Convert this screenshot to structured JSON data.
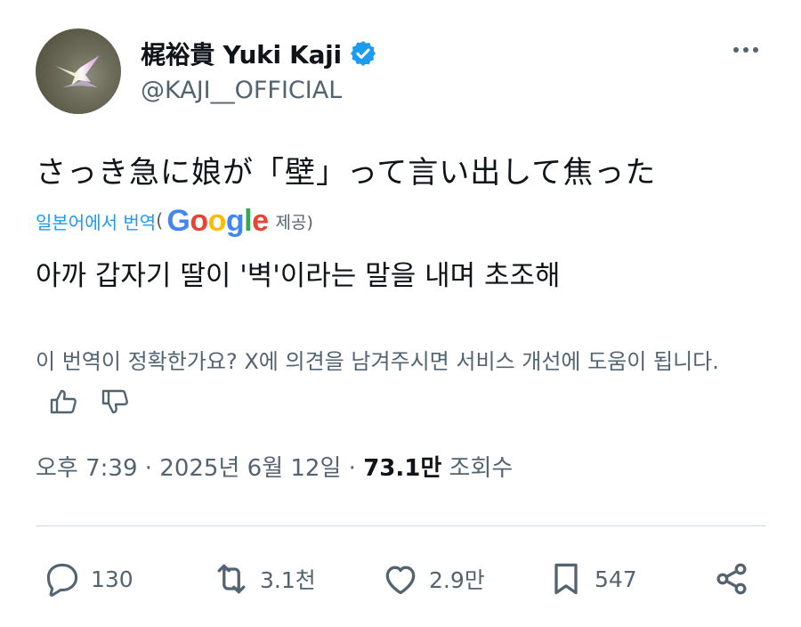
{
  "author": {
    "display_name": "梶裕貴 Yuki Kaji",
    "handle": "@KAJI__OFFICIAL",
    "verified_icon": "verified-badge-icon",
    "accent": "#1d9bf0"
  },
  "tweet": {
    "text": "さっき急に娘が「壁」って言い出して焦った"
  },
  "translation": {
    "link_label": "일본어에서 번역",
    "open_paren": "(",
    "provider": "Google",
    "provided_label": "제공)",
    "text": "아까 갑자기 딸이 '벽'이라는 말을 내며 초조해",
    "feedback_text": "이 번역이 정확한가요? X에 의견을 남겨주시면 서비스 개선에 도움이 됩니다."
  },
  "meta": {
    "time": "오후 7:39",
    "sep1": " · ",
    "date": "2025년 6월 12일",
    "sep2": " · ",
    "views_count": "73.1만",
    "views_label": " 조회수"
  },
  "actions": {
    "replies": "130",
    "reposts": "3.1천",
    "likes": "2.9만",
    "bookmarks": "547"
  },
  "icons": [
    "more-icon",
    "verified-badge-icon",
    "thumbs-up-icon",
    "thumbs-down-icon",
    "reply-icon",
    "repost-icon",
    "like-icon",
    "bookmark-icon",
    "share-icon"
  ]
}
